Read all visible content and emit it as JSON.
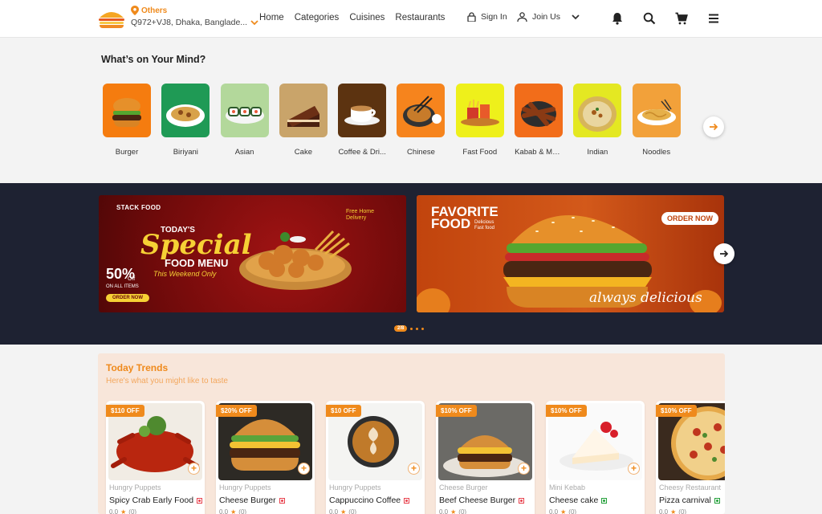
{
  "header": {
    "location_label": "Others",
    "address": "Q972+VJ8, Dhaka, Banglade...",
    "nav": [
      "Home",
      "Categories",
      "Cuisines",
      "Restaurants"
    ],
    "sign_in": "Sign In",
    "join_us": "Join Us",
    "accent": "#ef8a1c"
  },
  "mind": {
    "title": "What’s on Your Mind?",
    "categories": [
      {
        "label": "Burger",
        "bg": "#f57c0f"
      },
      {
        "label": "Biriyani",
        "bg": "#1f9a55"
      },
      {
        "label": "Asian",
        "bg": "#b3d89b"
      },
      {
        "label": "Cake",
        "bg": "#c9a46a"
      },
      {
        "label": "Coffee & Dri...",
        "bg": "#5c3310"
      },
      {
        "label": "Chinese",
        "bg": "#f6841d"
      },
      {
        "label": "Fast Food",
        "bg": "#eef01b"
      },
      {
        "label": "Kabab & More",
        "bg": "#f26d1a"
      },
      {
        "label": "Indian",
        "bg": "#e4e822"
      },
      {
        "label": "Noodles",
        "bg": "#f2a13a"
      }
    ]
  },
  "banners": {
    "b1": {
      "brand": "STACK FOOD",
      "line1": "TODAY'S",
      "line2": "Special",
      "line3": "FOOD MENU",
      "line4": "This Weekend Only",
      "discount": "50%",
      "discount_suffix": "Off",
      "on_items": "ON ALL ITEMS",
      "cta": "ORDER NOW",
      "note": "Free Home Delivery"
    },
    "b2": {
      "title1": "FAVORITE",
      "title2": "FOOD",
      "subtitle": "Delicious Fast food",
      "cta": "ORDER NOW",
      "script": "always delicious"
    },
    "pager": "2/8"
  },
  "trends": {
    "title": "Today Trends",
    "subtitle": "Here's what you might like to taste",
    "items": [
      {
        "off": "$110 OFF",
        "shop": "Hungry Puppets",
        "name": "Spicy Crab Early Food",
        "rating": "0.0",
        "count": "(0)",
        "veg": false,
        "img": "crab"
      },
      {
        "off": "$20% OFF",
        "shop": "Hungry Puppets",
        "name": "Cheese Burger",
        "rating": "0.0",
        "count": "(0)",
        "veg": false,
        "img": "burger"
      },
      {
        "off": "$10 OFF",
        "shop": "Hungry Puppets",
        "name": "Cappuccino Coffee",
        "rating": "0.0",
        "count": "(0)",
        "veg": false,
        "img": "coffee"
      },
      {
        "off": "$10% OFF",
        "shop": "Cheese Burger",
        "name": "Beef Cheese Burger",
        "rating": "0.0",
        "count": "(0)",
        "veg": false,
        "img": "beef"
      },
      {
        "off": "$10% OFF",
        "shop": "Mini Kebab",
        "name": "Cheese cake",
        "rating": "0.0",
        "count": "(0)",
        "veg": true,
        "img": "cake"
      },
      {
        "off": "$10% OFF",
        "shop": "Cheesy Restaurant",
        "name": "Pizza carnival",
        "rating": "0.0",
        "count": "(0)",
        "veg": true,
        "img": "pizza"
      }
    ]
  }
}
